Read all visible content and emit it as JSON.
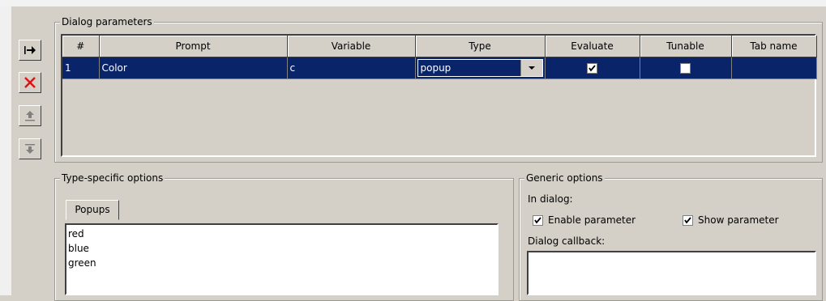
{
  "dialog_parameters": {
    "legend": "Dialog parameters",
    "columns": [
      "#",
      "Prompt",
      "Variable",
      "Type",
      "Evaluate",
      "Tunable",
      "Tab name"
    ],
    "rows": [
      {
        "num": "1",
        "prompt": "Color",
        "variable": "c",
        "type": "popup",
        "evaluate": true,
        "tunable": false,
        "tab_name": ""
      }
    ]
  },
  "toolbar": {
    "move_icon": "move-right-icon",
    "delete_icon": "delete-x-icon",
    "up_icon": "move-up-icon",
    "down_icon": "move-down-icon"
  },
  "type_specific": {
    "legend": "Type-specific options",
    "tab_label": "Popups",
    "items": [
      "red",
      "blue",
      "green"
    ]
  },
  "generic": {
    "legend": "Generic options",
    "in_dialog_label": "In dialog:",
    "enable_label": "Enable parameter",
    "enable_checked": true,
    "show_label": "Show parameter",
    "show_checked": true,
    "callback_label": "Dialog callback:",
    "callback_value": ""
  },
  "colors": {
    "selection": "#0a246a",
    "face": "#d4d0c8",
    "delete_red": "#e01010"
  }
}
